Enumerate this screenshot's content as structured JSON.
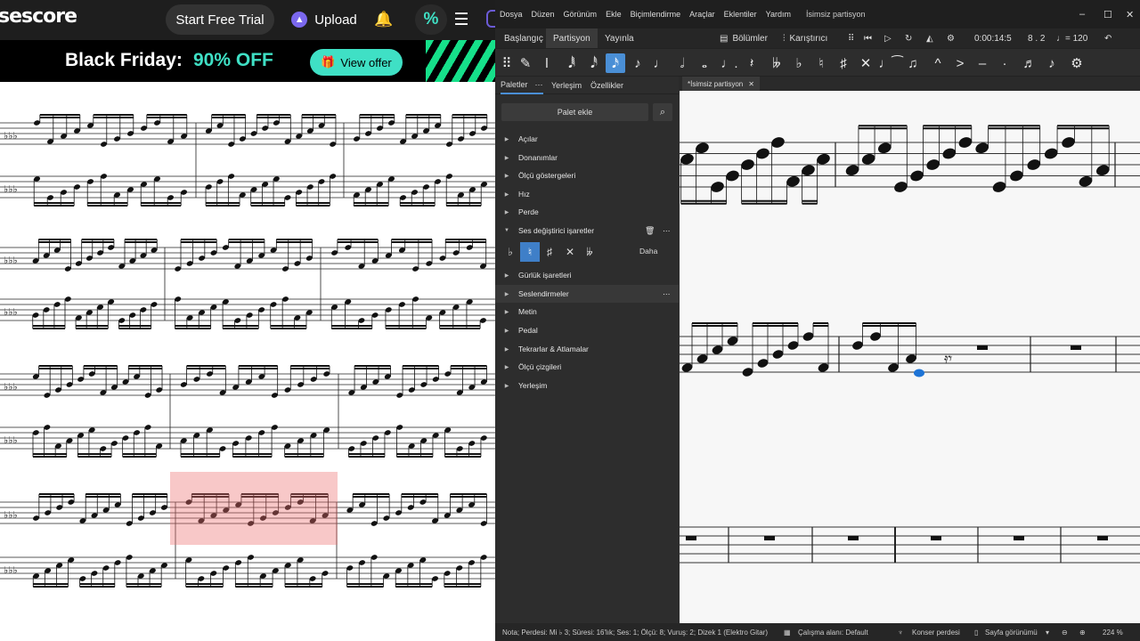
{
  "site": {
    "brand": "sescore",
    "trial_label": "Start Free Trial",
    "upload_label": "Upload",
    "promo_title": "Black Friday:",
    "promo_discount": "90% OFF",
    "view_offer": "View offer"
  },
  "app": {
    "menu": [
      "Dosya",
      "Düzen",
      "Görünüm",
      "Ekle",
      "Biçimlendirme",
      "Araçlar",
      "Eklentiler",
      "Yardım"
    ],
    "doc_title": "İsimsiz partisyon",
    "workspace_tabs": [
      "Başlangıç",
      "Partisyon",
      "Yayınla"
    ],
    "toolbar": {
      "parts_label": "Bölümler",
      "mixer_label": "Karıştırıcı",
      "time": "0:00:14:5",
      "position": "8 . 2",
      "tempo": "= 120"
    },
    "panel_tabs": [
      "Paletler",
      "Yerleşim",
      "Özellikler"
    ],
    "add_palette": "Palet ekle",
    "palettes": [
      "Açılar",
      "Donanımlar",
      "Ölçü göstergeleri",
      "Hız",
      "Perde",
      "Ses değiştirici işaretler",
      "Gürlük işaretleri",
      "Seslendirmeler",
      "Metin",
      "Pedal",
      "Tekrarlar & Atlamalar",
      "Ölçü çizgileri",
      "Yerleşim"
    ],
    "accidentals_more": "Daha",
    "score_tab": "*İsimsiz partisyon",
    "status": {
      "selection": "Nota; Perdesi: Mi ♭ 3; Süresi: 16'lık; Ses: 1; Ölçü: 8; Vuruş: 2; Dizek 1 (Elektro Gitar)",
      "workspace": "Çalışma alanı: Default",
      "concert": "Konser perdesi",
      "view": "Sayfa görünümü",
      "zoom": "224 %"
    }
  }
}
